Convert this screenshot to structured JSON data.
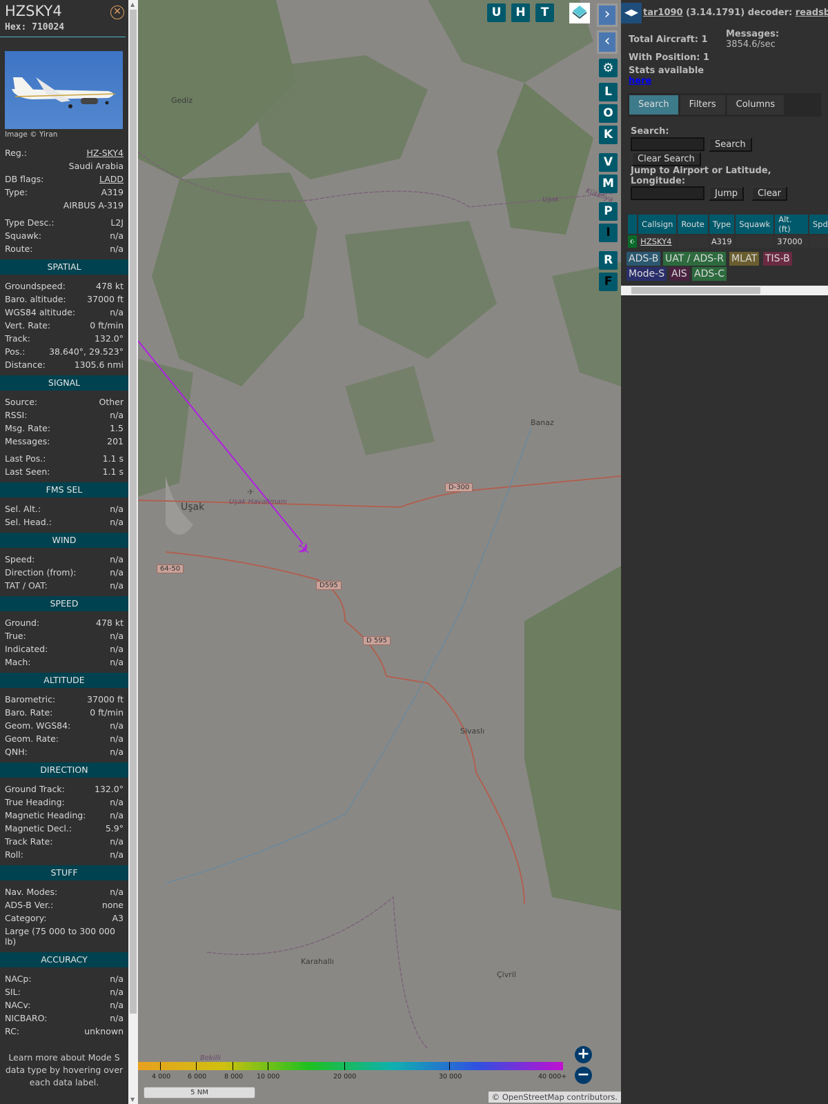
{
  "sidebar": {
    "title": "HZSKY4",
    "hex": "Hex: 710024",
    "image_credit": "Image © Yiran",
    "rows": [
      {
        "l": "Reg.:",
        "v": "HZ-SKY4",
        "link": true
      },
      {
        "l": "",
        "v": "Saudi Arabia"
      },
      {
        "l": "DB flags:",
        "v": "LADD",
        "link": true
      },
      {
        "l": "Type:",
        "v": "A319"
      },
      {
        "l": "",
        "v": "AIRBUS A-319"
      },
      {
        "gap": true
      },
      {
        "l": "Type Desc.:",
        "v": "L2J"
      },
      {
        "l": "Squawk:",
        "v": "n/a"
      },
      {
        "l": "Route:",
        "v": "n/a"
      },
      {
        "section": "SPATIAL"
      },
      {
        "l": "Groundspeed:",
        "v": "478 kt"
      },
      {
        "l": "Baro. altitude:",
        "v": "37000 ft"
      },
      {
        "l": "WGS84 altitude:",
        "v": "n/a"
      },
      {
        "l": "Vert. Rate:",
        "v": "0 ft/min"
      },
      {
        "l": "Track:",
        "v": "132.0°"
      },
      {
        "l": "Pos.:",
        "v": "38.640°, 29.523°"
      },
      {
        "l": "Distance:",
        "v": "1305.6 nmi"
      },
      {
        "section": "SIGNAL"
      },
      {
        "l": "Source:",
        "v": "Other"
      },
      {
        "l": "RSSI:",
        "v": "n/a"
      },
      {
        "l": "Msg. Rate:",
        "v": "1.5"
      },
      {
        "l": "Messages:",
        "v": "201"
      },
      {
        "gap": true
      },
      {
        "l": "Last Pos.:",
        "v": "1.1 s"
      },
      {
        "l": "Last Seen:",
        "v": "1.1 s"
      },
      {
        "section": "FMS SEL"
      },
      {
        "l": "Sel. Alt.:",
        "v": "n/a"
      },
      {
        "l": "Sel. Head.:",
        "v": "n/a"
      },
      {
        "section": "WIND"
      },
      {
        "l": "Speed:",
        "v": "n/a"
      },
      {
        "l": "Direction (from):",
        "v": "n/a"
      },
      {
        "l": "TAT / OAT:",
        "v": "n/a"
      },
      {
        "section": "SPEED"
      },
      {
        "l": "Ground:",
        "v": "478 kt"
      },
      {
        "l": "True:",
        "v": "n/a"
      },
      {
        "l": "Indicated:",
        "v": "n/a"
      },
      {
        "l": "Mach:",
        "v": "n/a"
      },
      {
        "section": "ALTITUDE"
      },
      {
        "l": "Barometric:",
        "v": "37000 ft"
      },
      {
        "l": "Baro. Rate:",
        "v": "0 ft/min"
      },
      {
        "l": "Geom. WGS84:",
        "v": "n/a"
      },
      {
        "l": "Geom. Rate:",
        "v": "n/a"
      },
      {
        "l": "QNH:",
        "v": "n/a"
      },
      {
        "section": "DIRECTION"
      },
      {
        "l": "Ground Track:",
        "v": "132.0°"
      },
      {
        "l": "True Heading:",
        "v": "n/a"
      },
      {
        "l": "Magnetic Heading:",
        "v": "n/a"
      },
      {
        "l": "Magnetic Decl.:",
        "v": "5.9°"
      },
      {
        "l": "Track Rate:",
        "v": "n/a"
      },
      {
        "l": "Roll:",
        "v": "n/a"
      },
      {
        "section": "STUFF"
      },
      {
        "l": "Nav. Modes:",
        "v": "n/a"
      },
      {
        "l": "ADS-B Ver.:",
        "v": "none"
      },
      {
        "l": "Category:",
        "v": "A3"
      },
      {
        "l": "Large (75 000 to 300 000 lb)",
        "v": "",
        "wrap": true
      },
      {
        "section": "ACCURACY"
      },
      {
        "l": "NACp:",
        "v": "n/a"
      },
      {
        "l": "SIL:",
        "v": "n/a"
      },
      {
        "l": "NACv:",
        "v": "n/a"
      },
      {
        "l": "NICBARO:",
        "v": "n/a"
      },
      {
        "l": "RC:",
        "v": "unknown"
      }
    ],
    "learn_more": "Learn more about Mode S data type by hovering over each data label."
  },
  "map": {
    "top_buttons": [
      "U",
      "H",
      "T"
    ],
    "side_buttons": [
      "L",
      "O",
      "K",
      "V",
      "M",
      "P",
      "I",
      "R",
      "F"
    ],
    "places": {
      "gediz": "Gediz",
      "usak": "Uşak",
      "usak_airport": "Uşak Havalimanı",
      "banaz": "Banaz",
      "sivasli": "Sivaslı",
      "karahalli": "Karahallı",
      "civril": "Çivril",
      "bekilli": "Bekilli",
      "kutahya": "Kütahya",
      "usak_region": "Uşak"
    },
    "roads": [
      "D-300",
      "D595",
      "D 595",
      "64-50"
    ],
    "altitude_legend": [
      "4 000",
      "6 000",
      "8 000",
      "10 000",
      "20 000",
      "30 000",
      "40 000+"
    ],
    "scale": "5 NM",
    "attribution": "© OpenStreetMap contributors.",
    "track_color": "#b020e0"
  },
  "right": {
    "header_app": "tar1090",
    "header_version": "(3.14.1791) decoder:",
    "header_decoder": "readsb",
    "total_aircraft": "Total Aircraft: 1",
    "with_position": "With Position: 1",
    "messages_label": "Messages:",
    "messages_value": "3854.6/sec",
    "stats": "Stats available",
    "stats_link": "here",
    "tabs": [
      "Search",
      "Filters",
      "Columns"
    ],
    "search_label": "Search:",
    "search_btn": "Search",
    "clear_search_btn": "Clear Search",
    "jump_label": "Jump to Airport or Latitude, Longitude:",
    "jump_btn": "Jump",
    "clear_btn": "Clear",
    "table": {
      "headers": [
        "Callsign",
        "Route",
        "Type",
        "Squawk",
        "Alt. (ft)",
        "Spd."
      ],
      "rows": [
        {
          "callsign": "HZSKY4",
          "route": "",
          "type": "A319",
          "squawk": "",
          "alt": "37000",
          "spd": ""
        }
      ]
    },
    "legend": [
      "ADS-B",
      "UAT / ADS-R",
      "MLAT",
      "TIS-B",
      "Mode-S",
      "AIS",
      "ADS-C"
    ]
  }
}
